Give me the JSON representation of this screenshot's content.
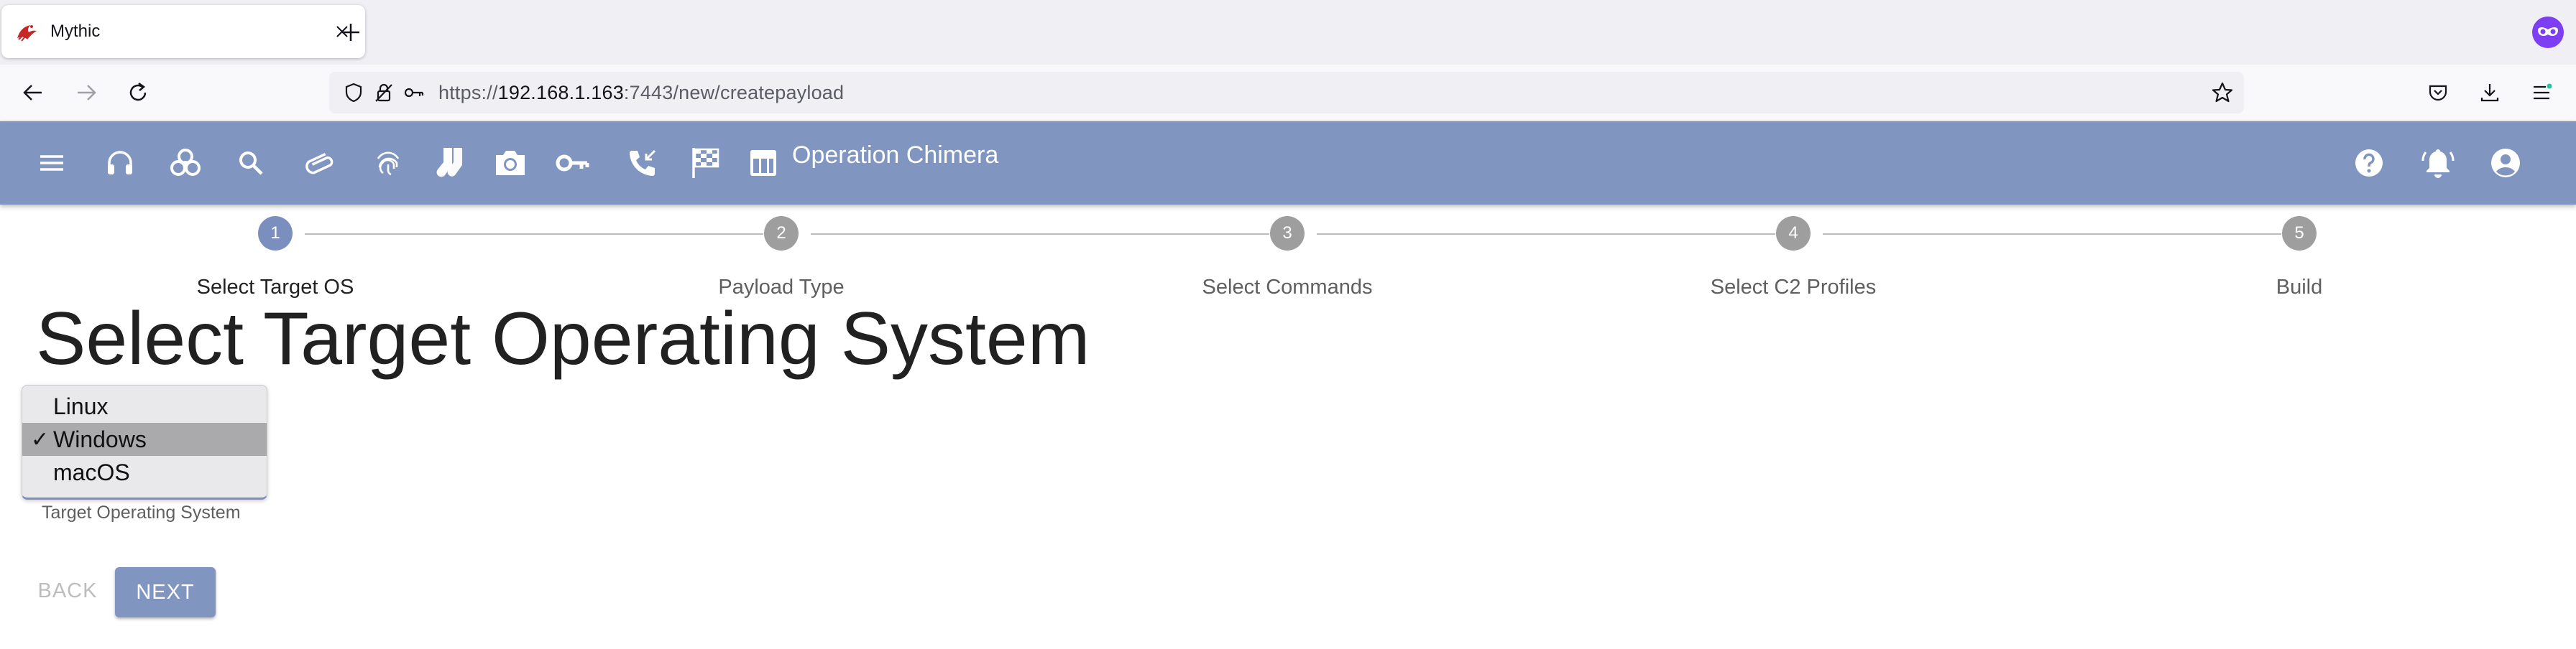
{
  "browser": {
    "tab_title": "Mythic",
    "url_scheme": "https://",
    "url_host": "192.168.1.163",
    "url_rest": ":7443/new/createpayload"
  },
  "app": {
    "operation_title": "Operation Chimera",
    "header_color": "#8095bf",
    "nav_icons": [
      "menu-icon",
      "headphones-icon",
      "biohazard-icon",
      "search-icon",
      "paperclip-icon",
      "fingerprint-icon",
      "socks-icon",
      "camera-icon",
      "key-icon",
      "phone-callback-icon",
      "checkered-flag-icon",
      "dashboard-table-icon"
    ],
    "right_icons": [
      "help-icon",
      "notifications-icon",
      "account-icon"
    ]
  },
  "stepper": {
    "steps": [
      {
        "number": "1",
        "label": "Select Target OS"
      },
      {
        "number": "2",
        "label": "Payload Type"
      },
      {
        "number": "3",
        "label": "Select Commands"
      },
      {
        "number": "4",
        "label": "Select C2 Profiles"
      },
      {
        "number": "5",
        "label": "Build"
      }
    ],
    "active_index": 0
  },
  "content": {
    "heading": "Select Target Operating System",
    "os_options": [
      "Linux",
      "Windows",
      "macOS"
    ],
    "selected_option": "Windows",
    "check_mark": "✓",
    "select_label": "Target Operating System",
    "back_label": "BACK",
    "next_label": "NEXT"
  }
}
